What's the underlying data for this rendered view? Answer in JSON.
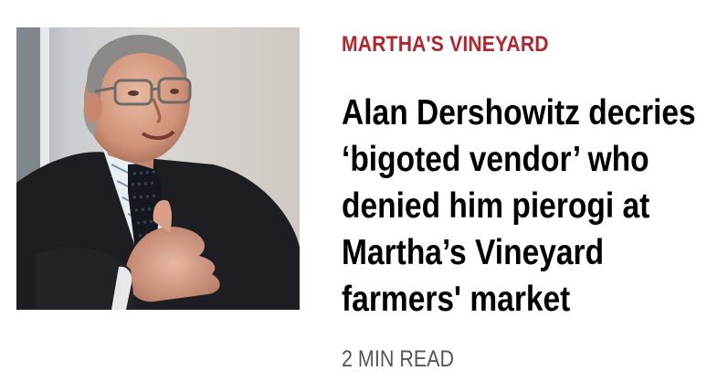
{
  "article": {
    "kicker": "MARTHA'S VINEYARD",
    "headline": "Alan Dershowitz decries ‘bigoted vendor’ who denied him pierogi at Martha’s Vineyard farmers' market",
    "read_time": "2 MIN READ",
    "image": {
      "subject": "photo-of-alan-dershowitz"
    }
  },
  "colors": {
    "kicker": "#b0262c",
    "headline": "#000000",
    "read_time": "#555555"
  }
}
